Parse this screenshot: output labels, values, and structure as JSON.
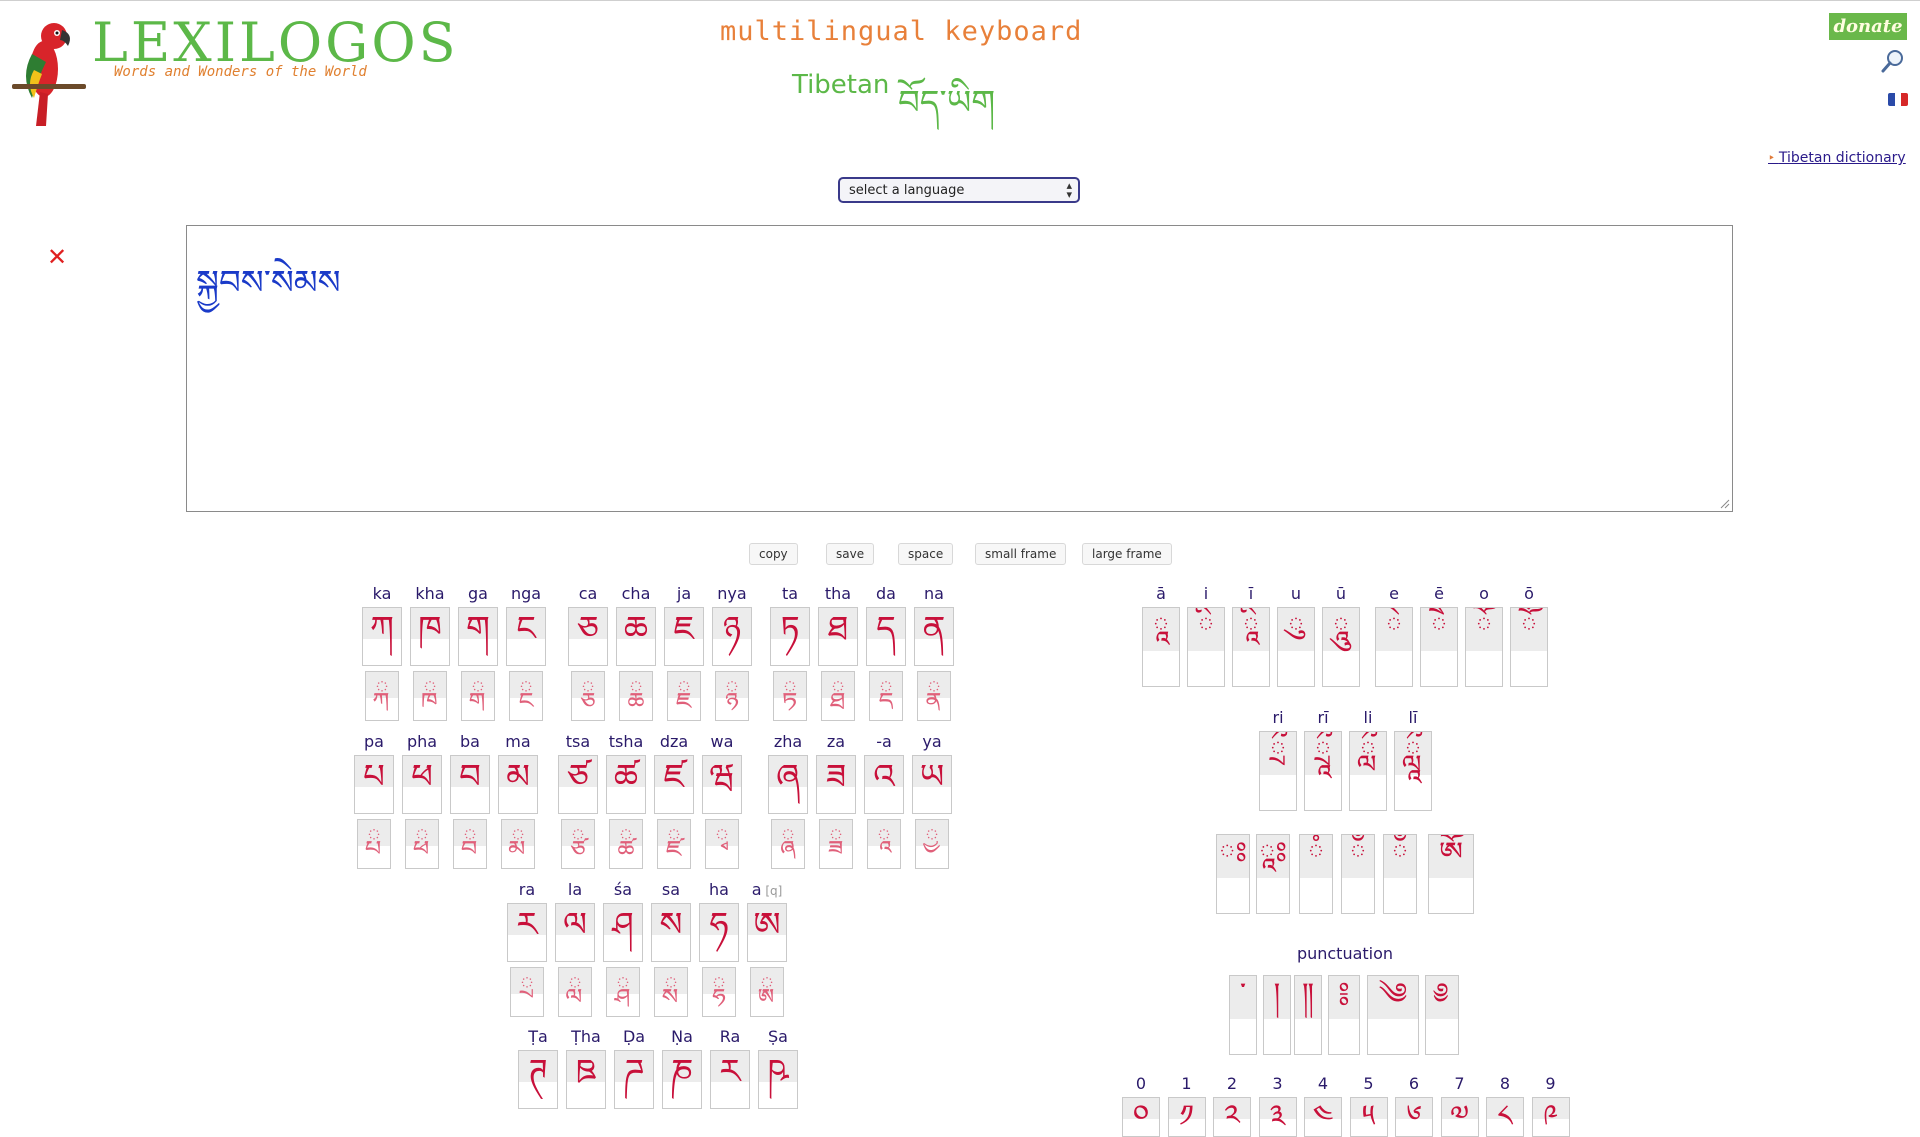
{
  "header": {
    "logo_word": "LEXILOGOS",
    "logo_tagline": "Words and Wonders of the World",
    "title": "multilingual keyboard",
    "subtitle": "Tibetan",
    "subtitle_native": "བོད་ཡིག",
    "donate_label": "donate",
    "dictionary_link": "Tibetan dictionary",
    "icons": {
      "search": "search-icon",
      "flag": "french-flag-icon",
      "clear": "close-icon"
    },
    "colors": {
      "green": "#5cb848",
      "orange": "#e8803a",
      "key_red": "#c8103a"
    }
  },
  "language_select": {
    "value": "select a language"
  },
  "editor": {
    "value": "སྐྱབས་སེམས"
  },
  "actions": {
    "copy": "copy",
    "save": "save",
    "space": "space",
    "small_frame": "small frame",
    "large_frame": "large frame"
  },
  "consonants": [
    [
      [
        {
          "l": "ka",
          "g": "ཀ",
          "s": "ྐ"
        },
        {
          "l": "kha",
          "g": "ཁ",
          "s": "ྑ"
        },
        {
          "l": "ga",
          "g": "ག",
          "s": "ྒ"
        },
        {
          "l": "nga",
          "g": "ང",
          "s": "ྔ"
        }
      ],
      [
        {
          "l": "ca",
          "g": "ཅ",
          "s": "ྕ"
        },
        {
          "l": "cha",
          "g": "ཆ",
          "s": "ྖ"
        },
        {
          "l": "ja",
          "g": "ཇ",
          "s": "ྗ"
        },
        {
          "l": "nya",
          "g": "ཉ",
          "s": "ྙ"
        }
      ],
      [
        {
          "l": "ta",
          "g": "ཏ",
          "s": "ྟ"
        },
        {
          "l": "tha",
          "g": "ཐ",
          "s": "ྠ"
        },
        {
          "l": "da",
          "g": "ད",
          "s": "ྡ"
        },
        {
          "l": "na",
          "g": "ན",
          "s": "ྣ"
        }
      ]
    ],
    [
      [
        {
          "l": "pa",
          "g": "པ",
          "s": "ྤ"
        },
        {
          "l": "pha",
          "g": "ཕ",
          "s": "ྥ"
        },
        {
          "l": "ba",
          "g": "བ",
          "s": "ྦ"
        },
        {
          "l": "ma",
          "g": "མ",
          "s": "ྨ"
        }
      ],
      [
        {
          "l": "tsa",
          "g": "ཙ",
          "s": "ྩ"
        },
        {
          "l": "tsha",
          "g": "ཚ",
          "s": "ྪ"
        },
        {
          "l": "dza",
          "g": "ཛ",
          "s": "ྫ"
        },
        {
          "l": "wa",
          "g": "ཝ",
          "s": "ྭ"
        }
      ],
      [
        {
          "l": "zha",
          "g": "ཞ",
          "s": "ྮ"
        },
        {
          "l": "za",
          "g": "ཟ",
          "s": "ྯ"
        },
        {
          "l": "-a",
          "g": "འ",
          "s": "ཱ"
        },
        {
          "l": "ya",
          "g": "ཡ",
          "s": "ྱ"
        }
      ]
    ],
    [
      [
        {
          "l": "ra",
          "g": "ར",
          "s": "ྲ"
        },
        {
          "l": "la",
          "g": "ལ",
          "s": "ླ"
        },
        {
          "l": "śa",
          "g": "ཤ",
          "s": "ྴ"
        },
        {
          "l": "sa",
          "g": "ས",
          "s": "ྶ"
        },
        {
          "l": "ha",
          "g": "ཧ",
          "s": "ྷ"
        },
        {
          "l": "a",
          "hint": "[q]",
          "g": "ཨ",
          "s": "ྸ"
        }
      ]
    ],
    [
      [
        {
          "l": "Ṭa",
          "g": "ཊ",
          "s": ""
        },
        {
          "l": "Ṭha",
          "g": "ཋ",
          "s": ""
        },
        {
          "l": "Ḍa",
          "g": "ཌ",
          "s": ""
        },
        {
          "l": "Ṇa",
          "g": "ཎ",
          "s": ""
        },
        {
          "l": "Ra",
          "g": "ཪ",
          "s": ""
        },
        {
          "l": "Ṣa",
          "g": "ཥ",
          "s": ""
        }
      ]
    ]
  ],
  "vowels": [
    {
      "l": "ā",
      "g": "ཱ"
    },
    {
      "l": "i",
      "g": "ི"
    },
    {
      "l": "ī",
      "g": "ཱི"
    },
    {
      "l": "u",
      "g": "ུ"
    },
    {
      "l": "ū",
      "g": "ཱུ"
    },
    {
      "l": "e",
      "g": "ེ"
    },
    {
      "l": "ē",
      "g": "ཻ"
    },
    {
      "l": "o",
      "g": "ོ"
    },
    {
      "l": "ō",
      "g": "ཽ"
    }
  ],
  "vocalic": [
    {
      "l": "ri",
      "g": "ྲྀ"
    },
    {
      "l": "rī",
      "g": "ཷ"
    },
    {
      "l": "li",
      "g": "ླྀ"
    },
    {
      "l": "lī",
      "g": "ཹ"
    }
  ],
  "marks": [
    "ཿ",
    "ཱཿ",
    "ཾ",
    "ྃ",
    "ྂ",
    "ༀ"
  ],
  "punctuation_label": "punctuation",
  "punctuation": [
    "་",
    "།",
    "༎",
    "༔",
    "༄",
    "༅"
  ],
  "digits": [
    {
      "l": "0",
      "g": "༠"
    },
    {
      "l": "1",
      "g": "༡"
    },
    {
      "l": "2",
      "g": "༢"
    },
    {
      "l": "3",
      "g": "༣"
    },
    {
      "l": "4",
      "g": "༤"
    },
    {
      "l": "5",
      "g": "༥"
    },
    {
      "l": "6",
      "g": "༦"
    },
    {
      "l": "7",
      "g": "༧"
    },
    {
      "l": "8",
      "g": "༨"
    },
    {
      "l": "9",
      "g": "༩"
    }
  ]
}
